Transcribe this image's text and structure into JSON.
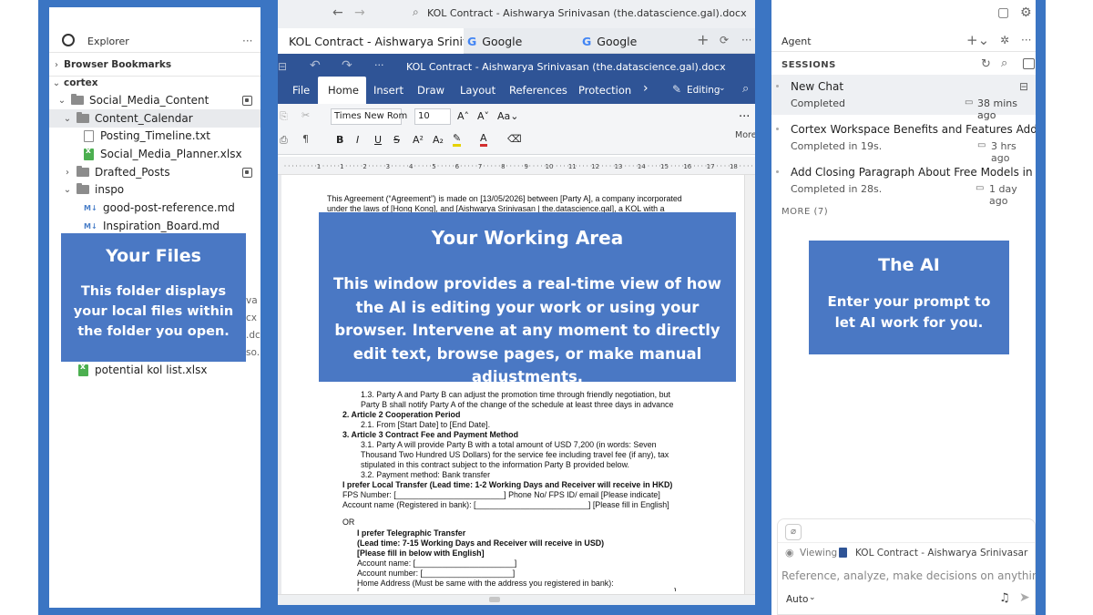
{
  "colors": {
    "frame": "#3b75c3",
    "ribbon": "#2f5496",
    "overlay": "#4a78c4"
  },
  "left": {
    "explorer_title": "Explorer",
    "more_glyph": "···",
    "browser_bookmarks": "Browser Bookmarks",
    "root": "cortex",
    "items": [
      "Social_Media_Content",
      "Content_Calendar",
      "Posting_Timeline.txt",
      "Social_Media_Planner.xlsx",
      "Drafted_Posts",
      "inspo",
      "good-post-reference.md",
      "Inspiration_Board.md"
    ],
    "peek": [
      "va",
      "cx",
      ".dc",
      "so."
    ],
    "last_file": "potential kol list.xlsx",
    "overlay": {
      "title": "Your Files",
      "body": "This folder displays your local files within the folder you open."
    }
  },
  "center": {
    "address": "KOL Contract - Aishwarya Srinivasan (the.datascience.gal).docx",
    "tabs": [
      "KOL Contract - Aishwarya Srinivas",
      "Google",
      "Google"
    ],
    "doc_title": "KOL Contract - Aishwarya Srinivasan (the.datascience.gal).docx",
    "menu": [
      "File",
      "Home",
      "Insert",
      "Draw",
      "Layout",
      "References",
      "Protection"
    ],
    "editing": "Editing",
    "font_name": "Times New Rom",
    "font_size": "10",
    "more_label": "More",
    "ruler_marks": [
      "1",
      "1",
      "2",
      "3",
      "4",
      "5",
      "6",
      "7",
      "8",
      "9",
      "10",
      "11",
      "12",
      "13",
      "14",
      "15",
      "16",
      "17",
      "18"
    ],
    "doc_lines": [
      "This Agreement (“Agreement”) is made on [13/05/2026] between [Party A], a company incorporated",
      "under the laws of [Hong Kong], and [Aishwarya Srinivasan | the.datascience.gal], a KOL with a",
      "1.3. Party A and Party B can adjust the promotion time through friendly negotiation, but",
      "Party B shall notify Party A of the change of the schedule at least three days in advance",
      "2. Article 2 Cooperation Period",
      "2.1. From [Start Date] to [End Date].",
      "3. Article 3 Contract Fee and Payment Method",
      "3.1. Party A will provide Party B with a total amount of USD 7,200 (in words: Seven",
      "Thousand Two Hundred US Dollars) for the service fee including travel fee (if any), tax",
      "stipulated in this contract subject to the information Party B provided below.",
      "3.2. Payment method: Bank transfer",
      "I prefer Local Transfer (Lead time: 1-2 Working Days and Receiver will receive in HKD)",
      "FPS Number: [________________________] Phone No/ FPS ID/ email [Please indicate]",
      "Account name (Registered in bank): [_________________________] [Please fill in English]",
      "OR",
      "I prefer Telegraphic Transfer",
      "(Lead time: 7-15 Working Days and Receiver will receive in USD)",
      "[Please fill in below with English]",
      "Account name: [______________________]",
      "Account number: [____________________]",
      "Home Address (Must be same with the address you registered in bank):",
      "[______________________________________________________________________]"
    ],
    "overlay": {
      "title": "Your Working Area",
      "body": "This window provides a real-time view of how the AI is editing your work or using your browser. Intervene at any moment to directly edit text, browse pages, or make manual adjustments."
    }
  },
  "right": {
    "agent_title": "Agent",
    "sessions_label": "SESSIONS",
    "sessions": [
      {
        "title": "New Chat",
        "status": "Completed",
        "time": "38 mins ago"
      },
      {
        "title": "Cortex Workspace Benefits and Features Additi...",
        "status": "Completed in 19s.",
        "time": "3 hrs ago"
      },
      {
        "title": "Add Closing Paragraph About Free Models in C...",
        "status": "Completed in 28s.",
        "time": "1 day ago"
      }
    ],
    "more": "MORE (7)",
    "viewing_label": "Viewing",
    "viewing_doc": "KOL Contract - Aishwarya Srinivasar",
    "placeholder": "Reference, analyze, make decisions on anything",
    "model": "Auto",
    "overlay": {
      "title": "The AI",
      "body": "Enter your prompt to let AI work for you."
    }
  }
}
